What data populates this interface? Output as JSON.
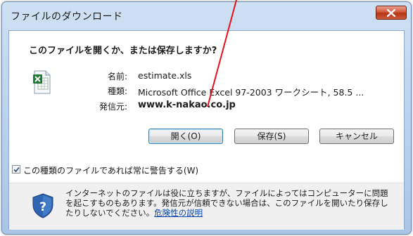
{
  "window": {
    "title": "ファイルのダウンロード"
  },
  "dialog": {
    "question": "このファイルを開くか、または保存しますか?",
    "file": {
      "icon": "excel-file-icon",
      "name_label": "名前:",
      "name_value": "estimate.xls",
      "type_label": "種類:",
      "type_value": "Microsoft Office Excel 97-2003 ワークシート, 58.5 ...",
      "from_label": "発信元:",
      "from_value": "www.k-nakao.co.jp"
    },
    "buttons": {
      "open": "開く(O)",
      "save": "保存(S)",
      "cancel": "キャンセル"
    },
    "checkbox": {
      "label": "この種類のファイルであれば常に警告する(W)",
      "checked": true
    },
    "info": {
      "icon": "security-shield-icon",
      "text": "インターネットのファイルは役に立ちますが、ファイルによってはコンピューターに問題を起こすものもあります。発信元が信頼できない場合は、このファイルを開いたり保存したりしないでください。",
      "link": "危険性の説明"
    }
  },
  "colors": {
    "annotation_line": "#e8101a",
    "link": "#0645ad",
    "close_button": "#c94a2c"
  }
}
